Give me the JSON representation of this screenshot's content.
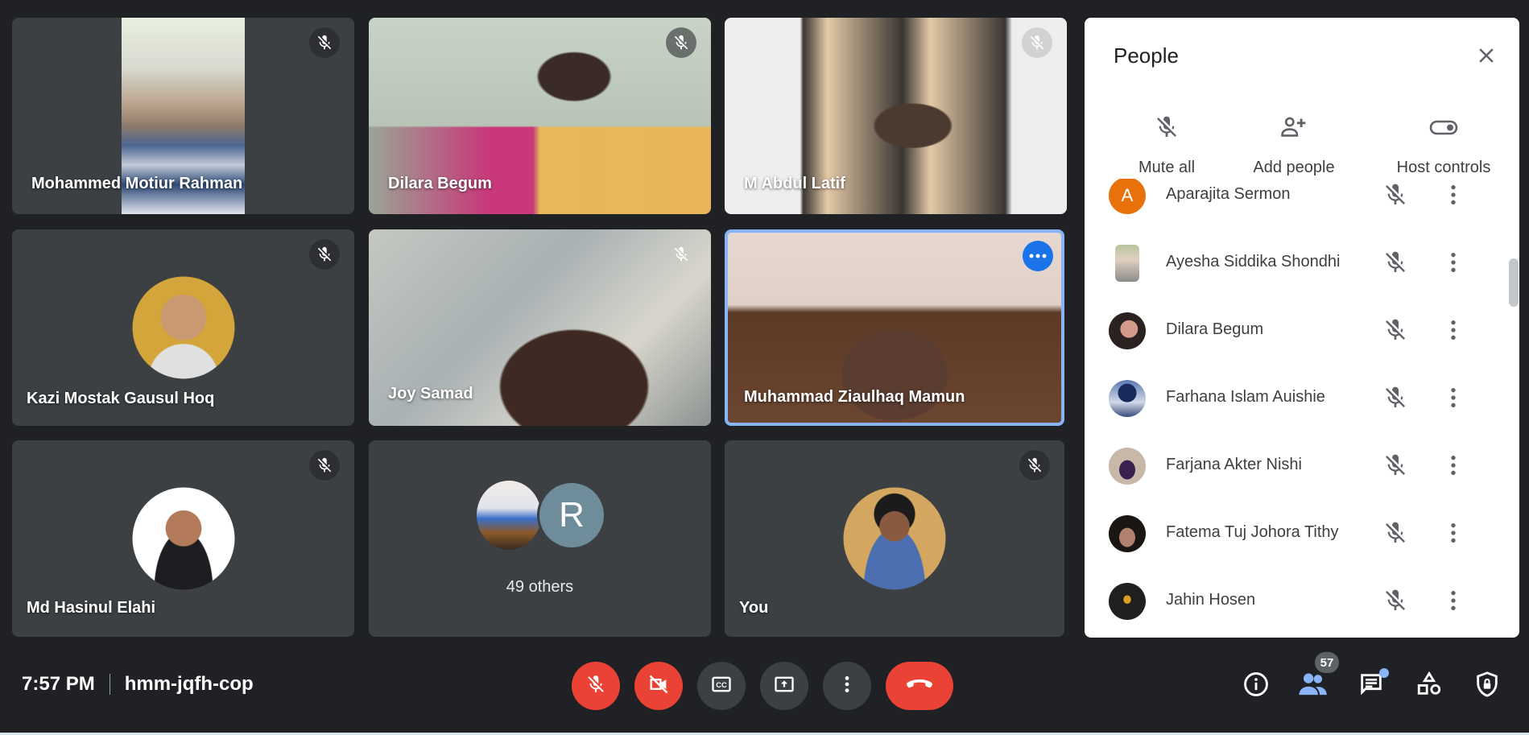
{
  "tiles": [
    {
      "name": "Mohammed Motiur Rahman",
      "muted": true,
      "type": "video"
    },
    {
      "name": "Dilara Begum",
      "muted": true,
      "type": "video"
    },
    {
      "name": "M Abdul Latif",
      "muted": true,
      "type": "video"
    },
    {
      "name": "Kazi Mostak Gausul Hoq",
      "muted": true,
      "type": "avatar"
    },
    {
      "name": "Joy Samad",
      "muted": true,
      "type": "video"
    },
    {
      "name": "Muhammad Ziaulhaq Mamun",
      "muted": false,
      "type": "video",
      "active_speaker": true
    },
    {
      "name": "Md Hasinul Elahi",
      "muted": true,
      "type": "avatar"
    },
    {
      "name": "49 others",
      "type": "group",
      "group_initial": "R"
    },
    {
      "name": "You",
      "muted": true,
      "type": "avatar"
    }
  ],
  "panel": {
    "title": "People",
    "close_icon": "close-icon",
    "actions": [
      {
        "label": "Mute all",
        "icon": "mic-off-icon"
      },
      {
        "label": "Add people",
        "icon": "person-add-icon"
      },
      {
        "label": "Host controls",
        "icon": "toggle-icon"
      }
    ],
    "participants": [
      {
        "name": "Aparajita Sermon",
        "initial": "A",
        "avatar_color": "#e8710a"
      },
      {
        "name": "Ayesha Siddika Shondhi"
      },
      {
        "name": "Dilara Begum"
      },
      {
        "name": "Farhana Islam Auishie"
      },
      {
        "name": "Farjana Akter Nishi"
      },
      {
        "name": "Fatema Tuj Johora Tithy"
      },
      {
        "name": "Jahin Hosen"
      }
    ]
  },
  "footer": {
    "time": "7:57 PM",
    "meeting_code": "hmm-jqfh-cop",
    "controls": [
      "mic-off",
      "camera-off",
      "captions",
      "present",
      "more",
      "hang-up"
    ],
    "right_controls": [
      "info",
      "people",
      "chat",
      "activities",
      "host-safety"
    ],
    "people_count": "57"
  },
  "colors": {
    "accent": "#8ab4f8",
    "danger": "#ea4335",
    "background": "#202124",
    "tile": "#3c4043"
  }
}
